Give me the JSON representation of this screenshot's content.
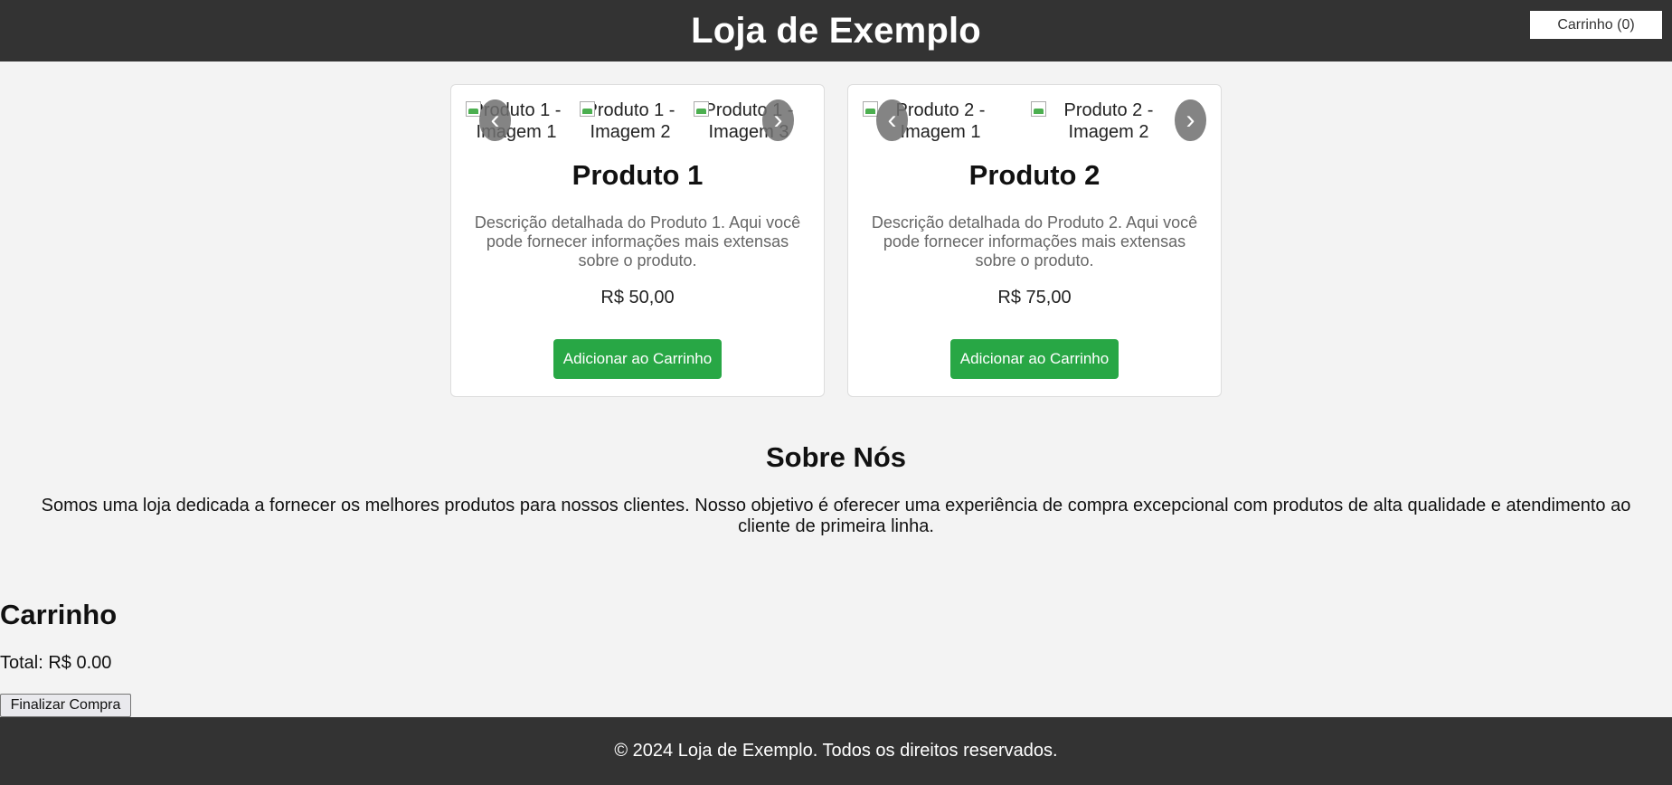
{
  "header": {
    "title": "Loja de Exemplo",
    "cart_button": "Carrinho (0)"
  },
  "products": [
    {
      "images": [
        "Produto 1 - Imagem 1",
        "Produto 1 - Imagem 2",
        "Produto 1 - Imagem 3"
      ],
      "prev_icon": "‹",
      "next_icon": "›",
      "name": "Produto 1",
      "description": "Descrição detalhada do Produto 1. Aqui você pode fornecer informações mais extensas sobre o produto.",
      "price": "R$ 50,00",
      "add_button": "Adicionar ao Carrinho"
    },
    {
      "images": [
        "Produto 2 - Imagem 1",
        "Produto 2 - Imagem 2"
      ],
      "prev_icon": "‹",
      "next_icon": "›",
      "name": "Produto 2",
      "description": "Descrição detalhada do Produto 2. Aqui você pode fornecer informações mais extensas sobre o produto.",
      "price": "R$ 75,00",
      "add_button": "Adicionar ao Carrinho"
    }
  ],
  "about": {
    "title": "Sobre Nós",
    "text": "Somos uma loja dedicada a fornecer os melhores produtos para nossos clientes. Nosso objetivo é oferecer uma experiência de compra excepcional com produtos de alta qualidade e atendimento ao cliente de primeira linha."
  },
  "cart": {
    "title": "Carrinho",
    "total": "Total: R$ 0.00",
    "checkout_button": "Finalizar Compra"
  },
  "footer": {
    "text": "© 2024 Loja de Exemplo. Todos os direitos reservados."
  },
  "colors": {
    "header_bg": "#333333",
    "page_bg": "#f3f3f3",
    "accent_green": "#28a745",
    "description_text": "#666666"
  }
}
